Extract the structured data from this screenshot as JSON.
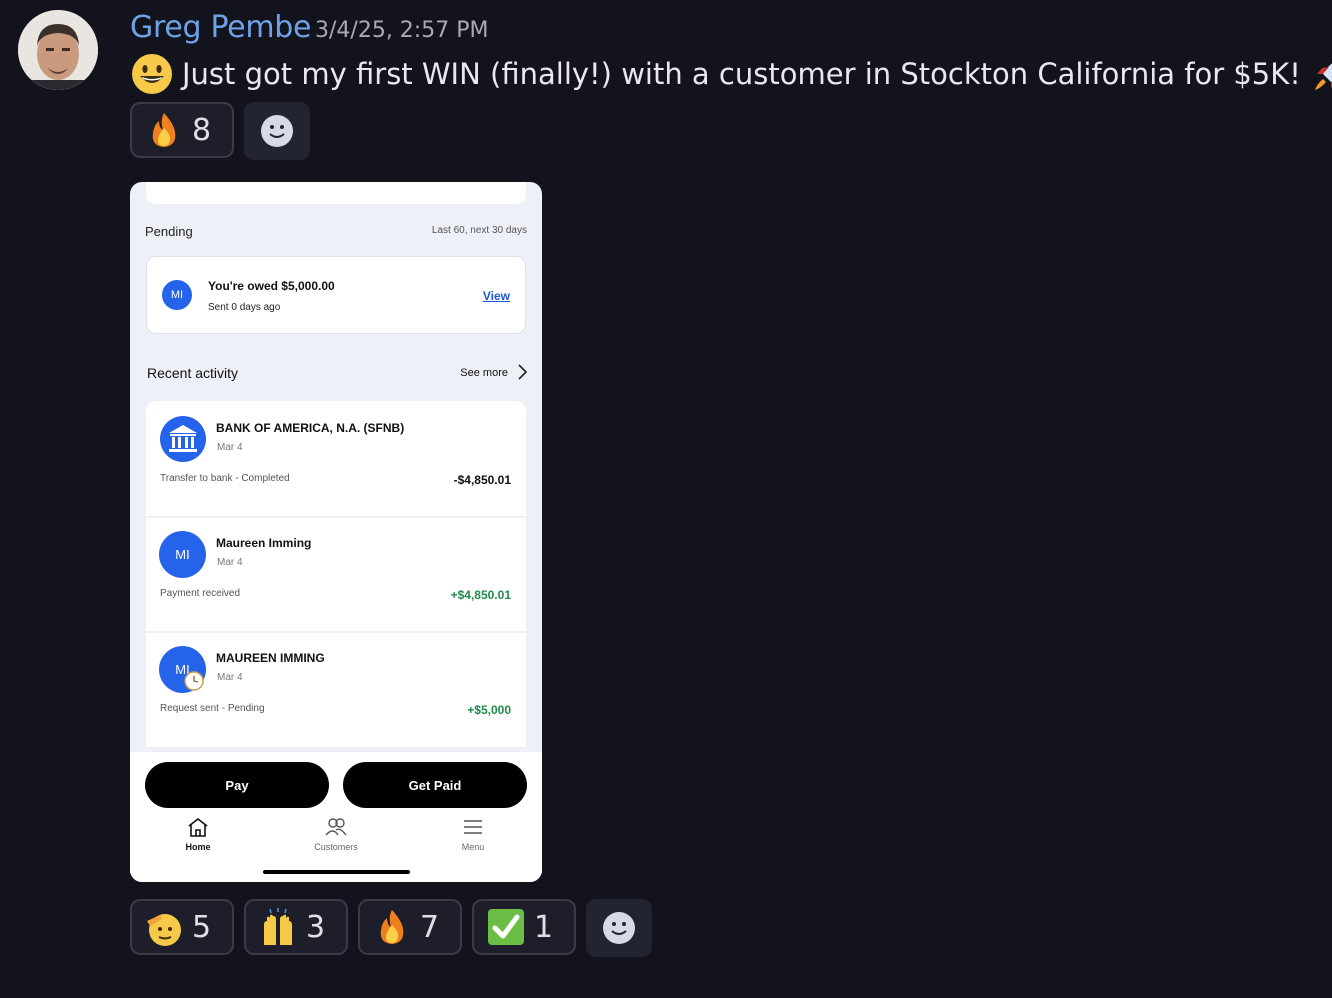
{
  "post": {
    "author": "Greg Pembe",
    "timestamp": "3/4/25, 2:57 PM",
    "message_leading_emoji": "grinning-face",
    "message": "Just got my first WIN (finally!) with a customer in Stockton California for $5K!",
    "message_trailing_emoji": "rocket"
  },
  "top_reactions": [
    {
      "emoji": "fire",
      "count": "8"
    }
  ],
  "bottom_reactions": [
    {
      "emoji": "saluting-face",
      "count": "5"
    },
    {
      "emoji": "raising-hands",
      "count": "3"
    },
    {
      "emoji": "fire",
      "count": "7"
    },
    {
      "emoji": "check-mark-button",
      "count": "1"
    }
  ],
  "screenshot": {
    "pending": {
      "title": "Pending",
      "range": "Last 60, next 30 days",
      "initials": "MI",
      "owed_title": "You're owed $5,000.00",
      "owed_sub": "Sent 0 days ago",
      "view": "View"
    },
    "recent": {
      "title": "Recent activity",
      "see_more": "See more"
    },
    "activities": [
      {
        "name": "BANK OF AMERICA, N.A. (SFNB)",
        "date": "Mar 4",
        "desc": "Transfer to bank - Completed",
        "amount": "-$4,850.01",
        "amount_color": "#111111",
        "icon": "bank-icon"
      },
      {
        "name": "Maureen Imming",
        "date": "Mar 4",
        "desc": "Payment received",
        "amount": "+$4,850.01",
        "amount_color": "#1f8a4c",
        "initials": "MI"
      },
      {
        "name": "MAUREEN IMMING",
        "date": "Mar 4",
        "desc": "Request sent - Pending",
        "amount": "+$5,000",
        "amount_color": "#1f8a4c",
        "initials": "MI"
      }
    ],
    "buttons": {
      "pay": "Pay",
      "get_paid": "Get Paid"
    },
    "nav": {
      "home": "Home",
      "customers": "Customers",
      "menu": "Menu"
    }
  },
  "colors": {
    "background": "#13131d",
    "author": "#6ea2e6",
    "accent_blue": "#2563eb",
    "positive": "#1f8a4c"
  }
}
